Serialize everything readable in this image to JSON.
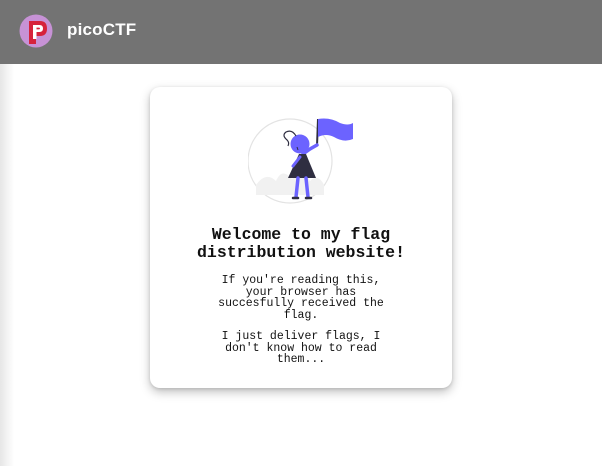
{
  "header": {
    "brand": "picoCTF",
    "logo_icon": "picoctf-logo-icon",
    "logo_colors": {
      "circle": "#c792d6",
      "mark": "#d6223c",
      "letter": "#ffffff"
    },
    "background": "#737373"
  },
  "card": {
    "illustration_icon": "woman-holding-flag-illustration",
    "accent_color": "#6c63ff",
    "title": "Welcome to my flag distribution website!",
    "paragraph_1": "If you're reading this, your browser has succesfully received the flag.",
    "paragraph_2": "I just deliver flags, I don't know how to read them..."
  }
}
